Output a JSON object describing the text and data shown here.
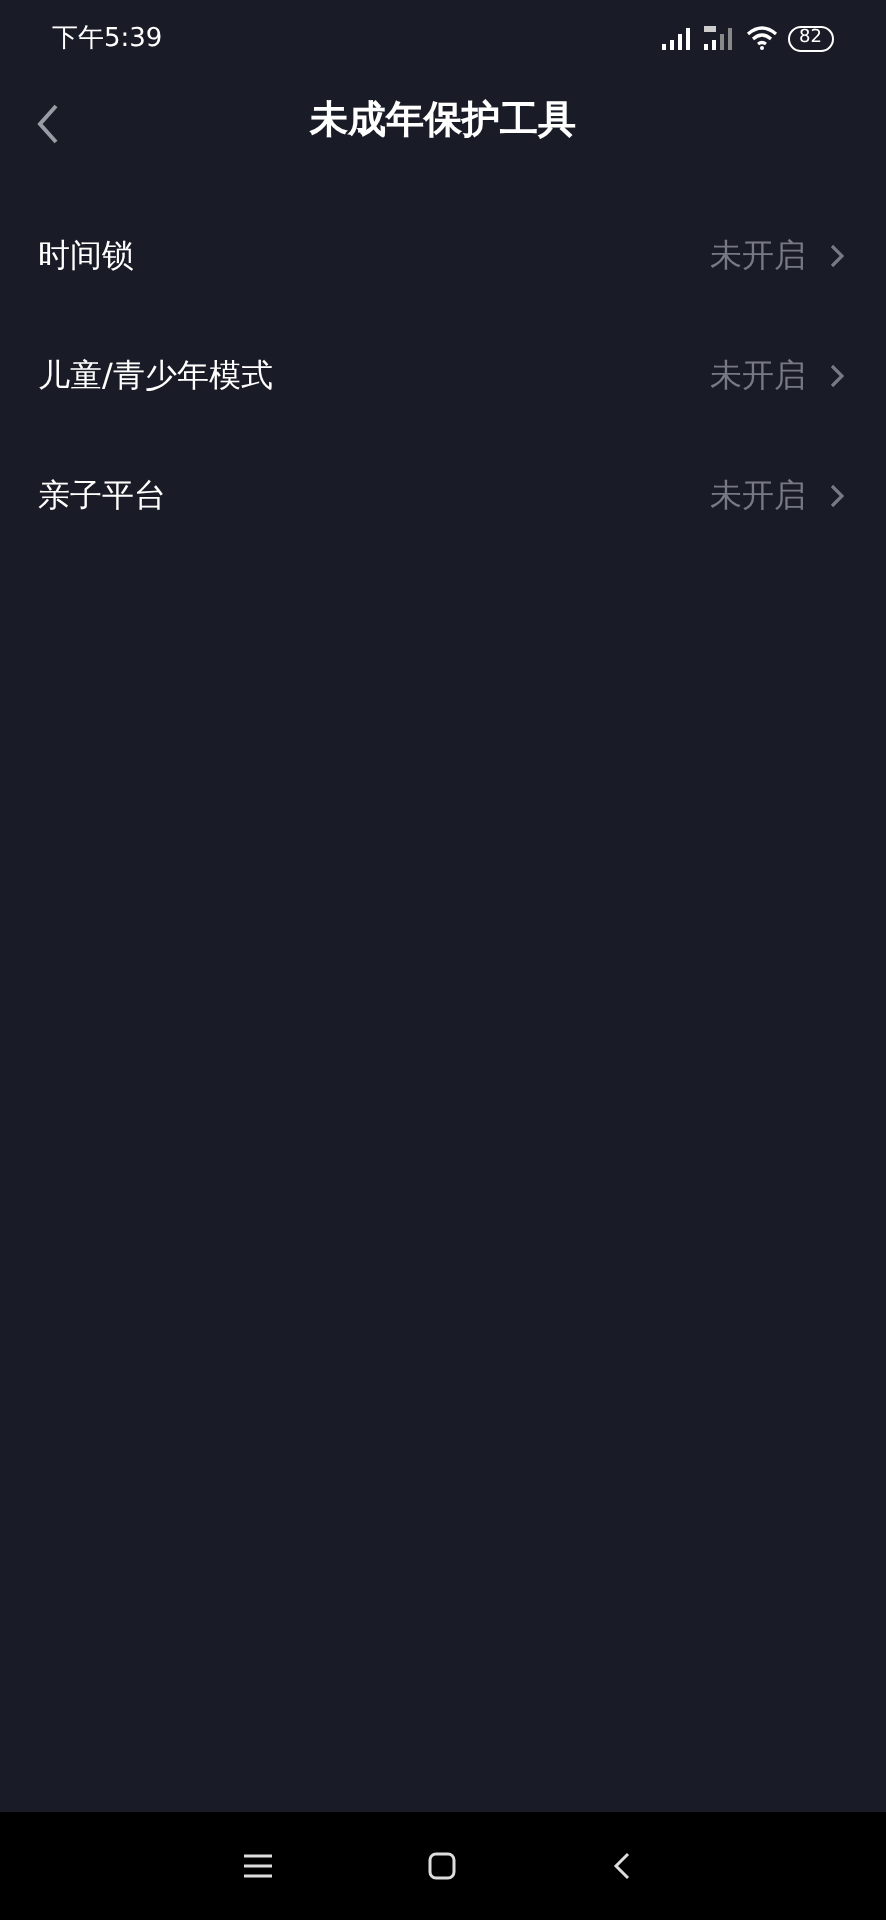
{
  "status_bar": {
    "time": "下午5:39",
    "battery": "82"
  },
  "header": {
    "title": "未成年保护工具"
  },
  "items": [
    {
      "label": "时间锁",
      "status": "未开启"
    },
    {
      "label": "儿童/青少年模式",
      "status": "未开启"
    },
    {
      "label": "亲子平台",
      "status": "未开启"
    }
  ]
}
